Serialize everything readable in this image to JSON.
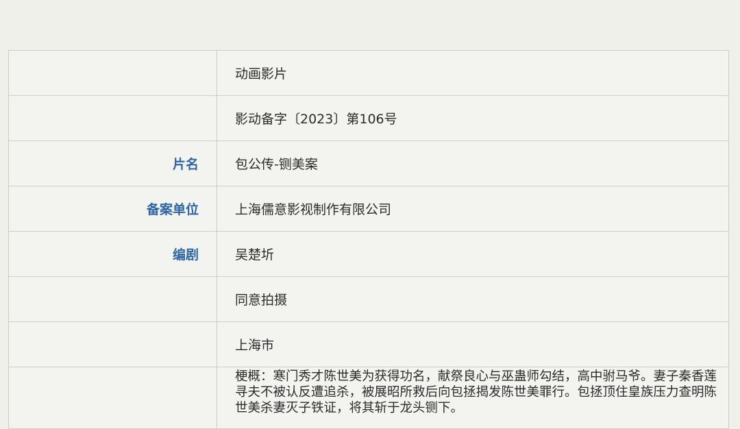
{
  "record": {
    "rows": [
      {
        "label": "",
        "value": "动画影片"
      },
      {
        "label": "",
        "value": "影动备字〔2023〕第106号"
      },
      {
        "label": "片名",
        "value": "包公传-铡美案"
      },
      {
        "label": "备案单位",
        "value": "上海儒意影视制作有限公司"
      },
      {
        "label": "编剧",
        "value": "吴楚圻"
      },
      {
        "label": "",
        "value": "同意拍摄"
      },
      {
        "label": "",
        "value": "上海市"
      }
    ],
    "summary": "梗概：寒门秀才陈世美为获得功名，献祭良心与巫蛊师勾结，高中驸马爷。妻子秦香莲寻夫不被认反遭追杀，被展昭所救后向包拯揭发陈世美罪行。包拯顶住皇族压力查明陈世美杀妻灭子铁证，将其斩于龙头铡下。"
  }
}
